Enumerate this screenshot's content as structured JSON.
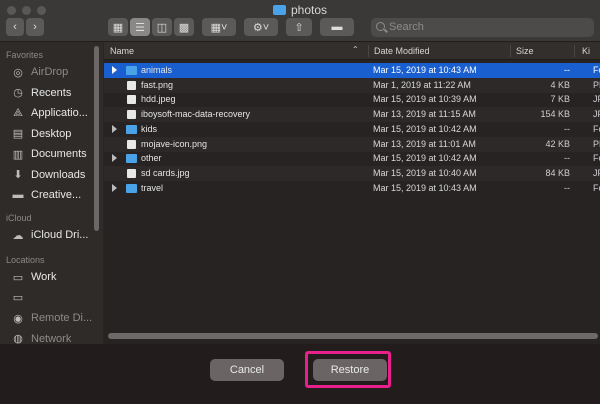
{
  "window": {
    "title": "photos"
  },
  "toolbar": {
    "search_placeholder": "Search"
  },
  "sidebar": {
    "favorites_header": "Favorites",
    "favorites": [
      {
        "label": "AirDrop",
        "icon": "airdrop-icon",
        "dim": true
      },
      {
        "label": "Recents",
        "icon": "clock-icon",
        "dim": false
      },
      {
        "label": "Applicatio...",
        "icon": "applications-icon",
        "dim": false
      },
      {
        "label": "Desktop",
        "icon": "desktop-icon",
        "dim": false
      },
      {
        "label": "Documents",
        "icon": "document-icon",
        "dim": false
      },
      {
        "label": "Downloads",
        "icon": "download-icon",
        "dim": false
      },
      {
        "label": "Creative...",
        "icon": "folder-icon",
        "dim": false
      }
    ],
    "icloud_header": "iCloud",
    "icloud": [
      {
        "label": "iCloud Dri...",
        "icon": "cloud-icon",
        "dim": false
      }
    ],
    "locations_header": "Locations",
    "locations": [
      {
        "label": "Work",
        "icon": "disk-icon",
        "dim": false
      },
      {
        "label": "",
        "icon": "disk-icon",
        "dim": true
      },
      {
        "label": "Remote Di...",
        "icon": "remote-disc-icon",
        "dim": true
      },
      {
        "label": "Network",
        "icon": "network-icon",
        "dim": true
      }
    ]
  },
  "columns": {
    "name": "Name",
    "date": "Date Modified",
    "size": "Size",
    "kind": "Ki"
  },
  "files": [
    {
      "name": "animals",
      "date": "Mar 15, 2019 at 10:43 AM",
      "size": "--",
      "kind": "Fo",
      "folder": true,
      "selected": true
    },
    {
      "name": "fast.png",
      "date": "Mar 1, 2019 at 11:22 AM",
      "size": "4 KB",
      "kind": "PN",
      "folder": false,
      "selected": false
    },
    {
      "name": "hdd.jpeg",
      "date": "Mar 15, 2019 at 10:39 AM",
      "size": "7 KB",
      "kind": "JP",
      "folder": false,
      "selected": false
    },
    {
      "name": "iboysoft-mac-data-recovery",
      "date": "Mar 13, 2019 at 11:15 AM",
      "size": "154 KB",
      "kind": "JP",
      "folder": false,
      "selected": false
    },
    {
      "name": "kids",
      "date": "Mar 15, 2019 at 10:42 AM",
      "size": "--",
      "kind": "Fo",
      "folder": true,
      "selected": false
    },
    {
      "name": "mojave-icon.png",
      "date": "Mar 13, 2019 at 11:01 AM",
      "size": "42 KB",
      "kind": "PN",
      "folder": false,
      "selected": false
    },
    {
      "name": "other",
      "date": "Mar 15, 2019 at 10:42 AM",
      "size": "--",
      "kind": "Fo",
      "folder": true,
      "selected": false
    },
    {
      "name": "sd cards.jpg",
      "date": "Mar 15, 2019 at 10:40 AM",
      "size": "84 KB",
      "kind": "JP",
      "folder": false,
      "selected": false
    },
    {
      "name": "travel",
      "date": "Mar 15, 2019 at 10:43 AM",
      "size": "--",
      "kind": "Fo",
      "folder": true,
      "selected": false
    }
  ],
  "footer": {
    "cancel_label": "Cancel",
    "restore_label": "Restore"
  },
  "colors": {
    "selection": "#1a5fd0",
    "folder": "#4aa3e8",
    "highlight": "#e8208c"
  }
}
